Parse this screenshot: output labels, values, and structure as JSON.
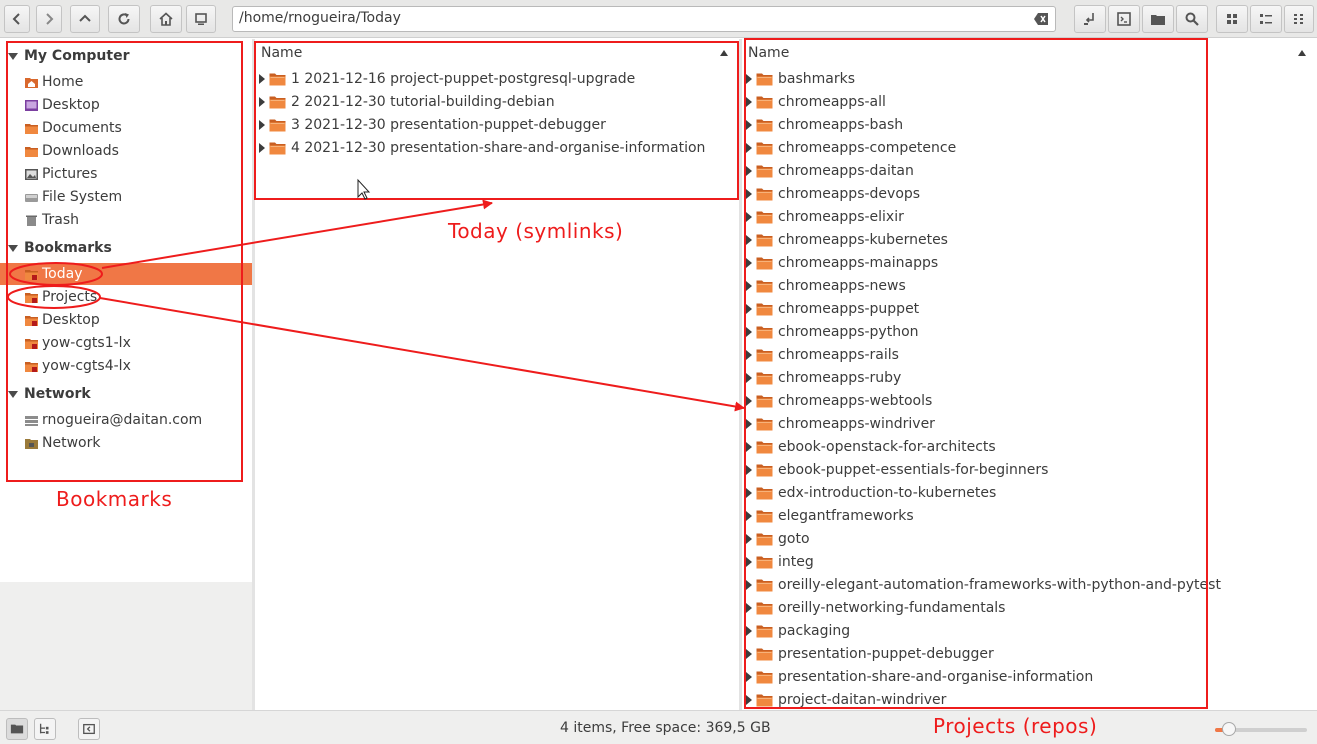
{
  "toolbar": {
    "path": "/home/rnogueira/Today",
    "buttons": [
      "back-icon",
      "forward-icon",
      "up-icon",
      "reload-icon",
      "home-icon",
      "computer-icon"
    ],
    "right_buttons": [
      "open-terminal-icon",
      "terminal-icon",
      "folder-open-icon",
      "search-icon",
      "icon-view-icon",
      "compact-view-icon",
      "list-view-icon"
    ]
  },
  "sidebar": {
    "sections": [
      {
        "title": "My Computer",
        "items": [
          {
            "label": "Home",
            "icon": "home-folder-icon"
          },
          {
            "label": "Desktop",
            "icon": "desktop-icon"
          },
          {
            "label": "Documents",
            "icon": "folder-icon"
          },
          {
            "label": "Downloads",
            "icon": "folder-icon"
          },
          {
            "label": "Pictures",
            "icon": "pictures-icon"
          },
          {
            "label": "File System",
            "icon": "drive-icon"
          },
          {
            "label": "Trash",
            "icon": "trash-icon"
          }
        ]
      },
      {
        "title": "Bookmarks",
        "items": [
          {
            "label": "Today",
            "icon": "bookmark-folder-icon",
            "selected": true
          },
          {
            "label": "Projects",
            "icon": "bookmark-folder-icon"
          },
          {
            "label": "Desktop",
            "icon": "bookmark-folder-icon"
          },
          {
            "label": "yow-cgts1-lx",
            "icon": "bookmark-folder-icon"
          },
          {
            "label": "yow-cgts4-lx",
            "icon": "bookmark-folder-icon"
          }
        ]
      },
      {
        "title": "Network",
        "items": [
          {
            "label": "rnogueira@daitan.com",
            "icon": "network-drive-icon"
          },
          {
            "label": "Network",
            "icon": "network-icon"
          }
        ]
      }
    ]
  },
  "middle_pane": {
    "column_header": "Name",
    "rows": [
      "1 2021-12-16 project-puppet-postgresql-upgrade",
      "2 2021-12-30 tutorial-building-debian",
      "3 2021-12-30 presentation-puppet-debugger",
      "4 2021-12-30 presentation-share-and-organise-information"
    ]
  },
  "right_pane": {
    "column_header": "Name",
    "rows": [
      "bashmarks",
      "chromeapps-all",
      "chromeapps-bash",
      "chromeapps-competence",
      "chromeapps-daitan",
      "chromeapps-devops",
      "chromeapps-elixir",
      "chromeapps-kubernetes",
      "chromeapps-mainapps",
      "chromeapps-news",
      "chromeapps-puppet",
      "chromeapps-python",
      "chromeapps-rails",
      "chromeapps-ruby",
      "chromeapps-webtools",
      "chromeapps-windriver",
      "ebook-openstack-for-architects",
      "ebook-puppet-essentials-for-beginners",
      "edx-introduction-to-kubernetes",
      "elegantframeworks",
      "goto",
      "integ",
      "oreilly-elegant-automation-frameworks-with-python-and-pytest",
      "oreilly-networking-fundamentals",
      "packaging",
      "presentation-puppet-debugger",
      "presentation-share-and-organise-information",
      "project-daitan-windriver"
    ]
  },
  "statusbar": {
    "text": "4 items, Free space: 369,5 GB",
    "zoom_fraction": 0.15
  },
  "annotations": {
    "bookmarks_label": "Bookmarks",
    "today_label": "Today (symlinks)",
    "projects_label": "Projects (repos)"
  },
  "colors": {
    "accent": "#f07746",
    "annotation": "#ee1c1c",
    "folder": "#e8793a"
  }
}
